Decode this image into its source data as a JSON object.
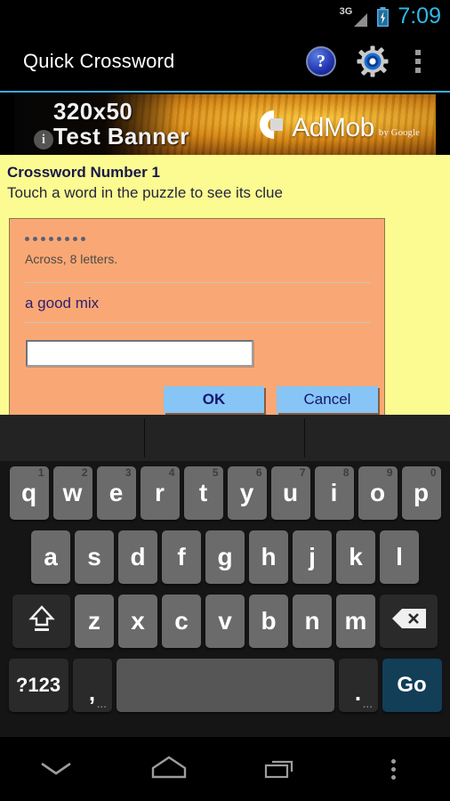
{
  "status_bar": {
    "network": "3G",
    "time": "7:09",
    "battery_icon": "battery-charging-icon",
    "signal_icon": "signal-3g-icon"
  },
  "action_bar": {
    "title": "Quick Crossword",
    "help_label": "?",
    "icons": [
      "help-icon",
      "settings-gear-icon",
      "overflow-menu-icon"
    ]
  },
  "ad_banner": {
    "line1": "320x50",
    "line2": "Test Banner",
    "brand": "AdMob",
    "brand_suffix": "by Google",
    "info_label": "i"
  },
  "content": {
    "title": "Crossword Number 1",
    "subtitle": "Touch a word in the puzzle to see its clue",
    "clue_panel": {
      "letter_count": 8,
      "meta": "Across, 8 letters.",
      "clue": "a good mix",
      "answer_value": "",
      "answer_placeholder": "",
      "ok_label": "OK",
      "cancel_label": "Cancel"
    }
  },
  "keyboard": {
    "suggestions": [
      "",
      "",
      ""
    ],
    "row1": [
      {
        "label": "q",
        "num": "1"
      },
      {
        "label": "w",
        "num": "2"
      },
      {
        "label": "e",
        "num": "3"
      },
      {
        "label": "r",
        "num": "4"
      },
      {
        "label": "t",
        "num": "5"
      },
      {
        "label": "y",
        "num": "6"
      },
      {
        "label": "u",
        "num": "7"
      },
      {
        "label": "i",
        "num": "8"
      },
      {
        "label": "o",
        "num": "9"
      },
      {
        "label": "p",
        "num": "0"
      }
    ],
    "row2": [
      {
        "label": "a"
      },
      {
        "label": "s"
      },
      {
        "label": "d"
      },
      {
        "label": "f"
      },
      {
        "label": "g"
      },
      {
        "label": "h"
      },
      {
        "label": "j"
      },
      {
        "label": "k"
      },
      {
        "label": "l"
      }
    ],
    "row3": [
      {
        "label": "z"
      },
      {
        "label": "x"
      },
      {
        "label": "c"
      },
      {
        "label": "v"
      },
      {
        "label": "b"
      },
      {
        "label": "n"
      },
      {
        "label": "m"
      }
    ],
    "shift_icon": "shift-arrow-icon",
    "backspace_icon": "backspace-icon",
    "symbols_label": "?123",
    "comma_label": ",",
    "comma_hint": "...",
    "space_label": "",
    "period_label": ".",
    "period_hint": "...",
    "go_label": "Go"
  },
  "nav_bar": {
    "items": [
      "hide-keyboard-chevron-icon",
      "home-icon",
      "recents-icon",
      "menu-dots-icon"
    ]
  },
  "colors": {
    "accent_blue": "#2fb9e8",
    "banner_yellow": "#fbfb91",
    "clue_peach": "#f9a875",
    "button_blue": "#86c5f6",
    "go_key": "#123e58",
    "title_navy": "#18184a"
  }
}
